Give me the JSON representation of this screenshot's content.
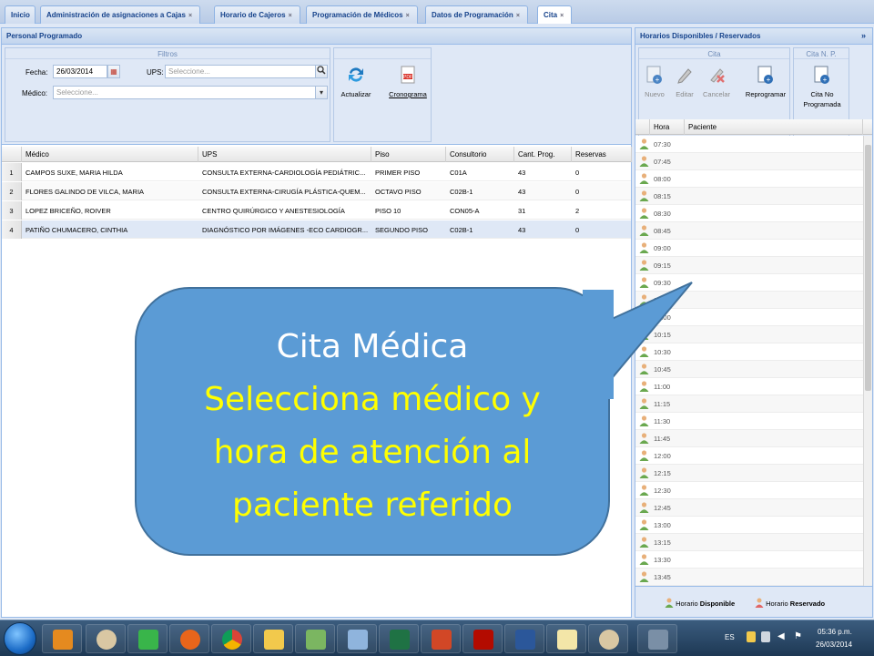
{
  "tabs": [
    {
      "label": "Inicio",
      "closable": false
    },
    {
      "label": "Administración de asignaciones a Cajas",
      "closable": true
    },
    {
      "label": "Horario de Cajeros",
      "closable": true
    },
    {
      "label": "Programación de Médicos",
      "closable": true
    },
    {
      "label": "Datos de Programación",
      "closable": true
    },
    {
      "label": "Cita",
      "closable": true,
      "active": true
    }
  ],
  "left_panel": {
    "title": "Personal Programado",
    "filters_title": "Filtros",
    "fecha_label": "Fecha:",
    "fecha_value": "26/03/2014",
    "ups_label": "UPS:",
    "ups_placeholder": "Seleccione...",
    "medico_label": "Médico:",
    "medico_placeholder": "Seleccione...",
    "btn_actualizar": "Actualizar",
    "btn_cronograma": "Cronograma"
  },
  "grid": {
    "columns": [
      "Médico",
      "UPS",
      "Piso",
      "Consultorio",
      "Cant. Prog.",
      "Reservas"
    ],
    "rows": [
      {
        "n": "1",
        "medico": "CAMPOS SUXE, MARIA HILDA",
        "ups": "CONSULTA EXTERNA-CARDIOLOGÍA PEDIÁTRIC...",
        "piso": "PRIMER PISO",
        "consultorio": "C01A",
        "cant": "43",
        "reservas": "0"
      },
      {
        "n": "2",
        "medico": "FLORES GALINDO DE VILCA, MARIA",
        "ups": "CONSULTA EXTERNA-CIRUGÍA PLÁSTICA-QUEM...",
        "piso": "OCTAVO PISO",
        "consultorio": "C02B-1",
        "cant": "43",
        "reservas": "0"
      },
      {
        "n": "3",
        "medico": "LOPEZ BRICEÑO, ROIVER",
        "ups": "CENTRO QUIRÚRGICO Y ANESTESIOLOGÍA",
        "piso": "PISO 10",
        "consultorio": "CON05-A",
        "cant": "31",
        "reservas": "2"
      },
      {
        "n": "4",
        "medico": "PATIÑO CHUMACERO, CINTHIA",
        "ups": "DIAGNÓSTICO POR IMÁGENES -ECO CARDIOGR...",
        "piso": "SEGUNDO PISO",
        "consultorio": "C02B-1",
        "cant": "43",
        "reservas": "0"
      }
    ]
  },
  "right_panel": {
    "title": "Horarios Disponibles / Reservados",
    "group_cita": "Cita",
    "group_cita_np": "Cita N. P.",
    "btn_nuevo": "Nuevo",
    "btn_editar": "Editar",
    "btn_cancelar": "Cancelar",
    "btn_reprogramar": "Reprogramar",
    "btn_cita_no_programada_1": "Cita No",
    "btn_cita_no_programada_2": "Programada",
    "col_hora": "Hora",
    "col_paciente": "Paciente",
    "horas": [
      "07:30",
      "07:45",
      "08:00",
      "08:15",
      "08:30",
      "08:45",
      "09:00",
      "09:15",
      "09:30",
      "09:45",
      "10:00",
      "10:15",
      "10:30",
      "10:45",
      "11:00",
      "11:15",
      "11:30",
      "11:45",
      "12:00",
      "12:15",
      "12:30",
      "12:45",
      "13:00",
      "13:15",
      "13:30",
      "13:45"
    ],
    "legend_prefix_1": "Horario ",
    "legend_bold_1": "Disponible",
    "legend_prefix_2": "Horario ",
    "legend_bold_2": "Reservado"
  },
  "callout": {
    "line1": "Cita Médica",
    "line2": "Selecciona médico y",
    "line3": "hora de atención al",
    "line4": "paciente referido"
  },
  "taskbar": {
    "lang": "ES",
    "time": "05:36 p.m.",
    "date": "26/03/2014"
  },
  "colors": {
    "available": "#6aa84f",
    "reserved": "#e06666",
    "callout_fill": "#5b9bd5",
    "callout_highlight": "#ffff00"
  }
}
